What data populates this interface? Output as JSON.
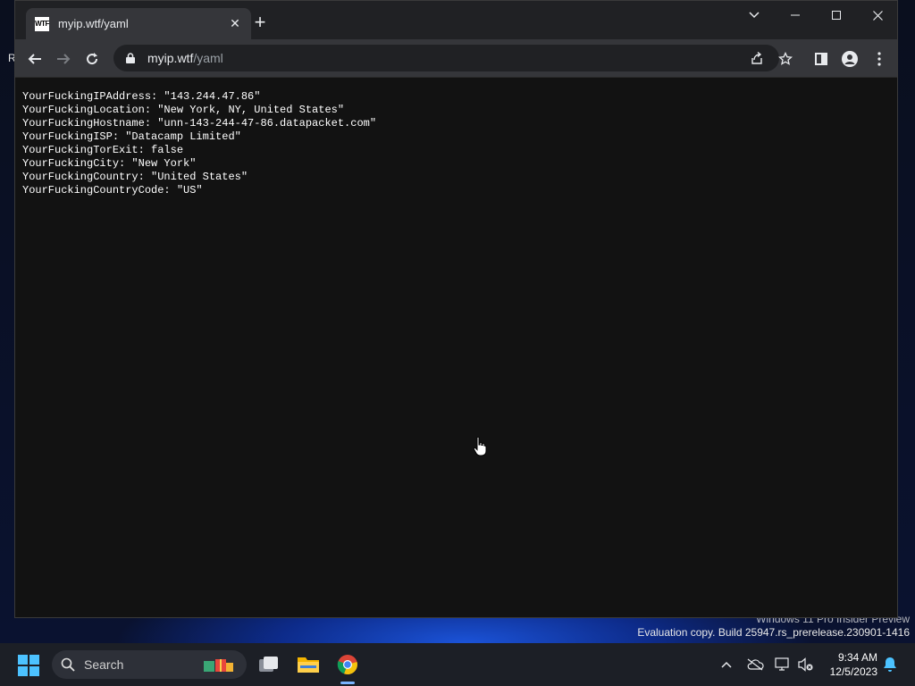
{
  "desktop": {
    "icon_letter": "R",
    "watermark_line1": "Windows 11 Pro Insider Preview",
    "watermark_line2": "Evaluation copy. Build 25947.rs_prerelease.230901-1416"
  },
  "browser": {
    "tab": {
      "favicon_text": "WTF",
      "title": "myip.wtf/yaml"
    },
    "url": {
      "host": "myip.wtf",
      "path": "/yaml"
    }
  },
  "content": {
    "lines": [
      "YourFuckingIPAddress: \"143.244.47.86\"",
      "YourFuckingLocation: \"New York, NY, United States\"",
      "YourFuckingHostname: \"unn-143-244-47-86.datapacket.com\"",
      "YourFuckingISP: \"Datacamp Limited\"",
      "YourFuckingTorExit: false",
      "YourFuckingCity: \"New York\"",
      "YourFuckingCountry: \"United States\"",
      "YourFuckingCountryCode: \"US\""
    ]
  },
  "taskbar": {
    "search_label": "Search",
    "time": "9:34 AM",
    "date": "12/5/2023"
  },
  "colors": {
    "page_bg": "#121212",
    "tab_active": "#35363a",
    "tabbar": "#202124",
    "taskbar": "#1c1f26"
  }
}
